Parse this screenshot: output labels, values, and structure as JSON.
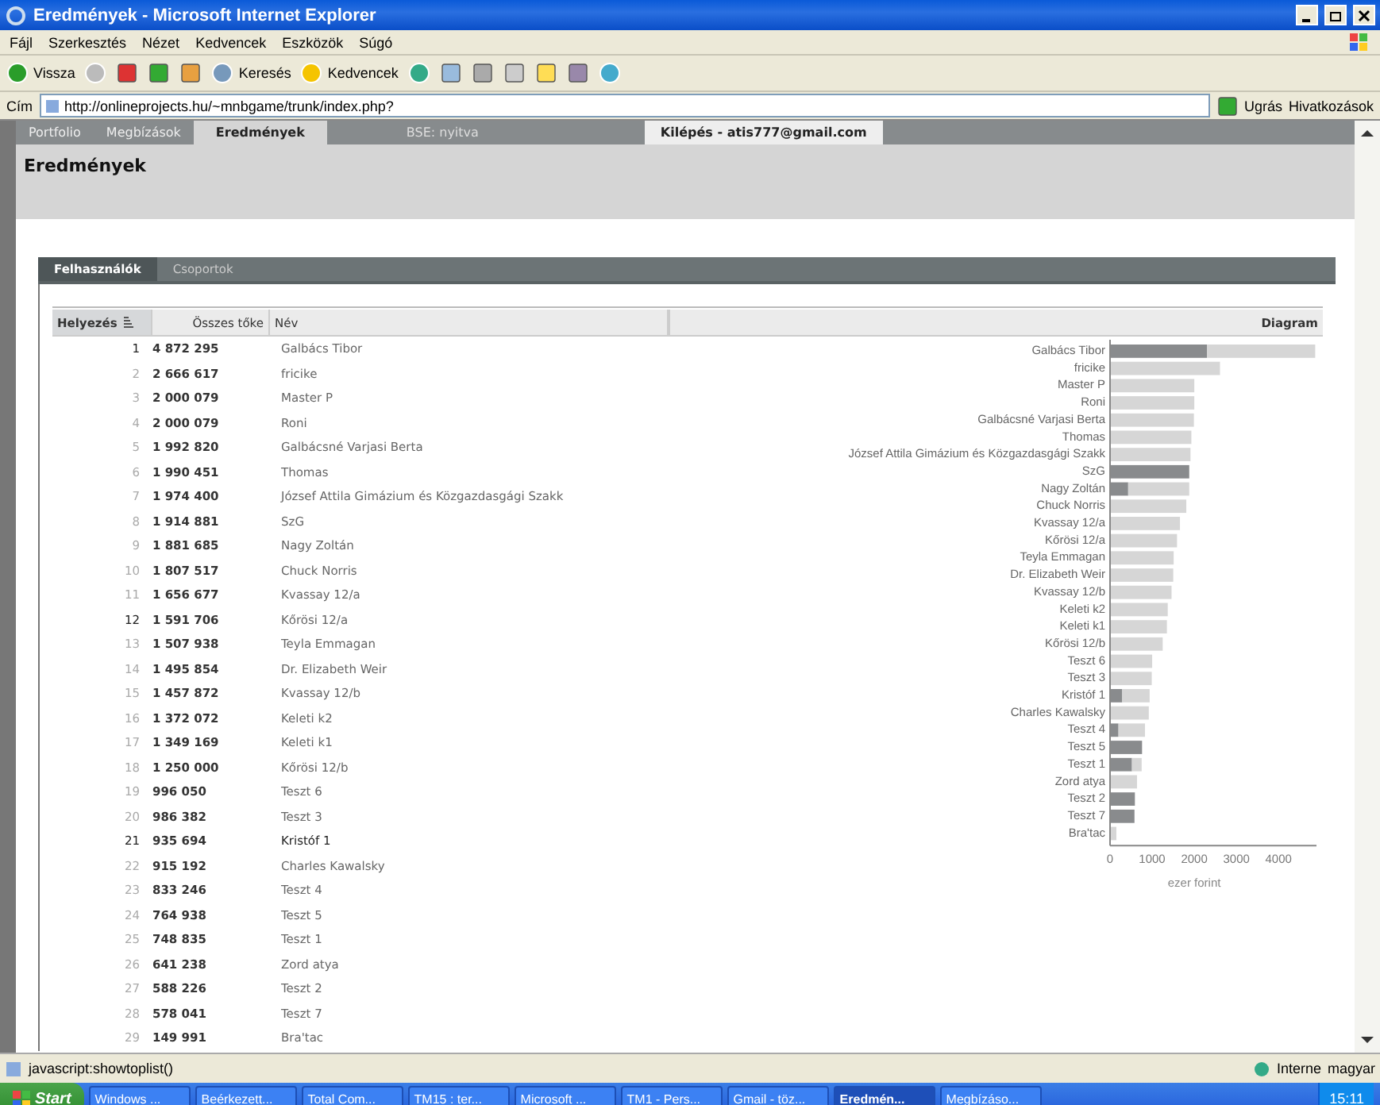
{
  "window": {
    "title": "Eredmények - Microsoft Internet Explorer"
  },
  "menu": [
    "Fájl",
    "Szerkesztés",
    "Nézet",
    "Kedvencek",
    "Eszközök",
    "Súgó"
  ],
  "toolbar": {
    "back": "Vissza",
    "search": "Keresés",
    "favorites": "Kedvencek"
  },
  "address": {
    "label": "Cím",
    "url": "http://onlineprojects.hu/~mnbgame/trunk/index.php?",
    "go": "Ugrás",
    "links": "Hivatkozások"
  },
  "nav": {
    "tabs": [
      {
        "label": "Portfolio",
        "selected": false
      },
      {
        "label": "Megbízások",
        "selected": false
      },
      {
        "label": "Eredmények",
        "selected": true
      }
    ],
    "market": "BSE: nyitva",
    "logout": "Kilépés - atis777@gmail.com"
  },
  "page_title": "Eredmények",
  "subtabs": [
    {
      "label": "Felhasználók",
      "selected": true
    },
    {
      "label": "Csoportok",
      "selected": false
    }
  ],
  "table": {
    "columns": [
      "Helyezés",
      "Összes tőke",
      "Név",
      "Diagram"
    ],
    "rows": [
      {
        "rank": "1",
        "capital": "4 872 295",
        "name": "Galbács Tibor",
        "emphasized": true
      },
      {
        "rank": "2",
        "capital": "2 666 617",
        "name": "fricike",
        "emphasized": false
      },
      {
        "rank": "3",
        "capital": "2 000 079",
        "name": "Master P",
        "emphasized": false
      },
      {
        "rank": "4",
        "capital": "2 000 079",
        "name": "Roni",
        "emphasized": false
      },
      {
        "rank": "5",
        "capital": "1 992 820",
        "name": "Galbácsné Varjasi Berta",
        "emphasized": false
      },
      {
        "rank": "6",
        "capital": "1 990 451",
        "name": "Thomas",
        "emphasized": false
      },
      {
        "rank": "7",
        "capital": "1 974 400",
        "name": "József Attila Gimázium és Közgazdasgági Szakk",
        "emphasized": false
      },
      {
        "rank": "8",
        "capital": "1 914 881",
        "name": "SzG",
        "emphasized": false
      },
      {
        "rank": "9",
        "capital": "1 881 685",
        "name": "Nagy Zoltán",
        "emphasized": false
      },
      {
        "rank": "10",
        "capital": "1 807 517",
        "name": "Chuck Norris",
        "emphasized": false
      },
      {
        "rank": "11",
        "capital": "1 656 677",
        "name": "Kvassay 12/a",
        "emphasized": false
      },
      {
        "rank": "12",
        "capital": "1 591 706",
        "name": "Kőrösi 12/a",
        "emphasized": true
      },
      {
        "rank": "13",
        "capital": "1 507 938",
        "name": "Teyla Emmagan",
        "emphasized": false
      },
      {
        "rank": "14",
        "capital": "1 495 854",
        "name": "Dr. Elizabeth Weir",
        "emphasized": false
      },
      {
        "rank": "15",
        "capital": "1 457 872",
        "name": "Kvassay 12/b",
        "emphasized": false
      },
      {
        "rank": "16",
        "capital": "1 372 072",
        "name": "Keleti k2",
        "emphasized": false
      },
      {
        "rank": "17",
        "capital": "1 349 169",
        "name": "Keleti k1",
        "emphasized": false
      },
      {
        "rank": "18",
        "capital": "1 250 000",
        "name": "Kőrösi 12/b",
        "emphasized": false
      },
      {
        "rank": "19",
        "capital": "996 050",
        "name": "Teszt 6",
        "emphasized": false
      },
      {
        "rank": "20",
        "capital": "986 382",
        "name": "Teszt 3",
        "emphasized": false
      },
      {
        "rank": "21",
        "capital": "935 694",
        "name": "Kristóf 1",
        "emphasized": true
      },
      {
        "rank": "22",
        "capital": "915 192",
        "name": "Charles Kawalsky",
        "emphasized": false
      },
      {
        "rank": "23",
        "capital": "833 246",
        "name": "Teszt 4",
        "emphasized": false
      },
      {
        "rank": "24",
        "capital": "764 938",
        "name": "Teszt 5",
        "emphasized": false
      },
      {
        "rank": "25",
        "capital": "748 835",
        "name": "Teszt 1",
        "emphasized": false
      },
      {
        "rank": "26",
        "capital": "641 238",
        "name": "Zord atya",
        "emphasized": false
      },
      {
        "rank": "27",
        "capital": "588 226",
        "name": "Teszt 2",
        "emphasized": false
      },
      {
        "rank": "28",
        "capital": "578 041",
        "name": "Teszt 7",
        "emphasized": false
      },
      {
        "rank": "29",
        "capital": "149 991",
        "name": "Bra'tac",
        "emphasized": false
      }
    ]
  },
  "chart_data": {
    "type": "bar",
    "orientation": "horizontal",
    "stacked": true,
    "xlabel": "ezer forint",
    "xlim": [
      0,
      4900
    ],
    "xticks": [
      0,
      1000,
      2000,
      3000,
      4000
    ],
    "categories": [
      "Galbács Tibor",
      "fricike",
      "Master P",
      "Roni",
      "Galbácsné Varjasi Berta",
      "Thomas",
      "József Attila Gimázium és Közgazdasgági Szakk",
      "SzG",
      "Nagy Zoltán",
      "Chuck Norris",
      "Kvassay 12/a",
      "Kőrösi 12/a",
      "Teyla Emmagan",
      "Dr. Elizabeth Weir",
      "Kvassay 12/b",
      "Keleti k2",
      "Keleti k1",
      "Kőrösi 12/b",
      "Teszt 6",
      "Teszt 3",
      "Kristóf 1",
      "Charles Kawalsky",
      "Teszt 4",
      "Teszt 5",
      "Teszt 1",
      "Zord atya",
      "Teszt 2",
      "Teszt 7",
      "Bra'tac"
    ],
    "series": [
      {
        "color": "#898b8d",
        "values": [
          2300,
          null,
          0,
          0,
          0,
          null,
          null,
          1880,
          430,
          0,
          0,
          0,
          0,
          0,
          0,
          0,
          0,
          0,
          0,
          0,
          290,
          0,
          200,
          760,
          520,
          0,
          590,
          580,
          0
        ]
      },
      {
        "color": "#d6d6d6",
        "values": [
          2570,
          2610,
          2000,
          2000,
          1990,
          1930,
          1910,
          null,
          1450,
          1810,
          1660,
          1590,
          1510,
          1500,
          1460,
          1370,
          1350,
          1250,
          1000,
          990,
          650,
          920,
          630,
          0,
          230,
          640,
          0,
          0,
          150
        ]
      }
    ]
  },
  "status_bar": {
    "text": "javascript:showtoplist()",
    "zone": "Interne",
    "language": "magyar"
  },
  "taskbar": {
    "start": "Start",
    "items": [
      {
        "label": "Windows ...",
        "selected": false
      },
      {
        "label": "Beérkezett...",
        "selected": false
      },
      {
        "label": "Total Com...",
        "selected": false
      },
      {
        "label": "TM15 : ter...",
        "selected": false
      },
      {
        "label": "Microsoft ...",
        "selected": false
      },
      {
        "label": "TM1 - Pers...",
        "selected": false
      },
      {
        "label": "Gmail - töz...",
        "selected": false
      },
      {
        "label": "Eredmén...",
        "selected": true
      },
      {
        "label": "Megbízáso...",
        "selected": false
      }
    ],
    "clock": "15:11"
  }
}
